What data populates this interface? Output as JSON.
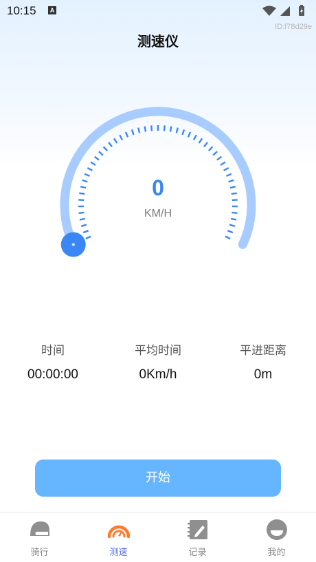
{
  "status_bar": {
    "time": "10:15",
    "notification_letter": "A"
  },
  "id_label": "ID:f78d29e",
  "header": {
    "title": "测速仪"
  },
  "speedometer": {
    "value": "0",
    "unit": "KM/H",
    "level_fraction": 0
  },
  "stats": [
    {
      "label": "时间",
      "value": "00:00:00"
    },
    {
      "label": "平均时间",
      "value": "0Km/h"
    },
    {
      "label": "平进距离",
      "value": "0m"
    }
  ],
  "start_button": {
    "label": "开始"
  },
  "tabs": [
    {
      "label": "骑行",
      "icon": "helmet-icon",
      "active": false
    },
    {
      "label": "测速",
      "icon": "speedometer-icon",
      "active": true
    },
    {
      "label": "记录",
      "icon": "notebook-icon",
      "active": false
    },
    {
      "label": "我的",
      "icon": "profile-icon",
      "active": false
    }
  ],
  "colors": {
    "accent": "#3a86f5",
    "gauge_track": "#a8ccff",
    "button": "#66b5ff",
    "active_tab_icon": "#ff7a2e",
    "active_tab_label": "#5b6ee8",
    "inactive_icon": "#8f8f8f"
  }
}
